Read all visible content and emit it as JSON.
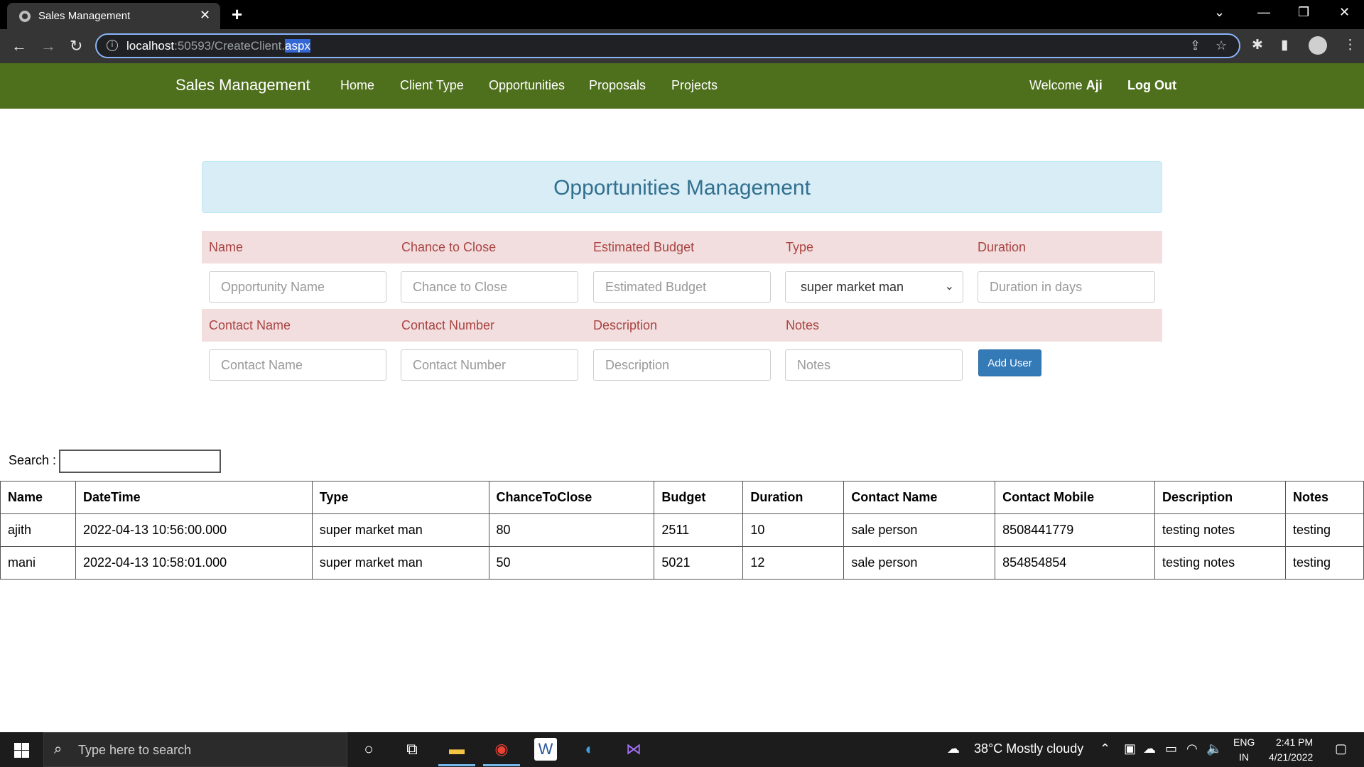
{
  "browser": {
    "tab_title": "Sales Management",
    "url_host": "localhost",
    "url_port_path": ":50593/CreateClient.",
    "url_selected": "aspx"
  },
  "nav": {
    "brand": "Sales Management",
    "links": [
      "Home",
      "Client Type",
      "Opportunities",
      "Proposals",
      "Projects"
    ],
    "welcome_prefix": "Welcome ",
    "welcome_user": "Aji",
    "logout": "Log Out"
  },
  "page": {
    "title": "Opportunities Management"
  },
  "form": {
    "row1_labels": [
      "Name",
      "Chance to Close",
      "Estimated Budget",
      "Type",
      "Duration"
    ],
    "row1_placeholders": {
      "name": "Opportunity Name",
      "chance": "Chance to Close",
      "budget": "Estimated Budget",
      "duration": "Duration in days"
    },
    "type_selected": "super market man",
    "row2_labels": [
      "Contact Name",
      "Contact Number",
      "Description",
      "Notes"
    ],
    "row2_placeholders": {
      "contact_name": "Contact Name",
      "contact_number": "Contact Number",
      "description": "Description",
      "notes": "Notes"
    },
    "add_button": "Add User"
  },
  "search": {
    "label": "Search :"
  },
  "table": {
    "headers": [
      "Name",
      "DateTime",
      "Type",
      "ChanceToClose",
      "Budget",
      "Duration",
      "Contact Name",
      "Contact Mobile",
      "Description",
      "Notes"
    ],
    "rows": [
      [
        "ajith",
        "2022-04-13 10:56:00.000",
        "super market man",
        "80",
        "2511",
        "10",
        "sale person",
        "8508441779",
        "testing notes",
        "testing"
      ],
      [
        "mani",
        "2022-04-13 10:58:01.000",
        "super market man",
        "50",
        "5021",
        "12",
        "sale person",
        "854854854",
        "testing notes",
        "testing"
      ]
    ]
  },
  "taskbar": {
    "search_placeholder": "Type here to search",
    "weather": "38°C  Mostly cloudy",
    "lang_top": "ENG",
    "lang_bottom": "IN",
    "time": "2:41 PM",
    "date": "4/21/2022"
  }
}
